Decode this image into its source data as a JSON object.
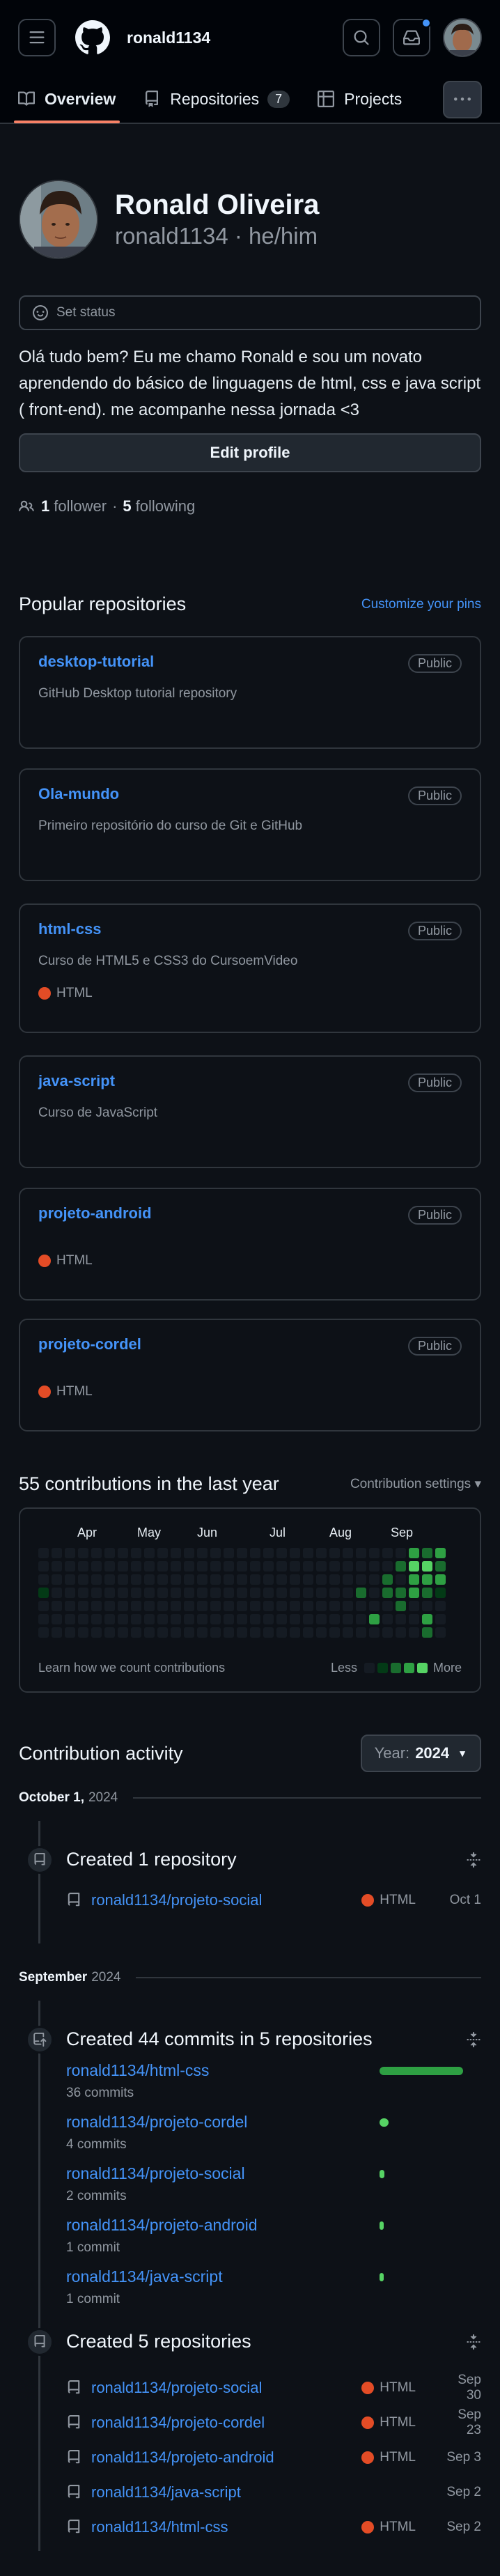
{
  "header": {
    "username": "ronald1134",
    "icons": [
      "menu-icon",
      "github-logo-icon",
      "search-icon",
      "inbox-icon"
    ],
    "has_notification": true
  },
  "tabs": [
    {
      "label": "Overview",
      "active": true
    },
    {
      "label": "Repositories",
      "count": "7"
    },
    {
      "label": "Projects"
    }
  ],
  "profile": {
    "name": "Ronald Oliveira",
    "login_line": "ronald1134 · he/him",
    "set_status": "Set status",
    "bio": "Olá tudo bem? Eu me chamo Ronald e sou um novato aprendendo do básico de linguagens de html, css e java script ( front-end). me acompanhe nessa jornada <3",
    "edit_profile": "Edit profile",
    "followers_count": "1",
    "followers_label": "follower",
    "separator": "·",
    "following_count": "5",
    "following_label": "following"
  },
  "popular": {
    "title": "Popular repositories",
    "customize": "Customize your pins",
    "repos": [
      {
        "name": "desktop-tutorial",
        "visibility": "Public",
        "description": "GitHub Desktop tutorial repository",
        "language": ""
      },
      {
        "name": "Ola-mundo",
        "visibility": "Public",
        "description": "Primeiro repositório do curso de Git e GitHub",
        "language": ""
      },
      {
        "name": "html-css",
        "visibility": "Public",
        "description": "Curso de HTML5 e CSS3 do CursoemVideo",
        "language": "HTML"
      },
      {
        "name": "java-script",
        "visibility": "Public",
        "description": "Curso de JavaScript",
        "language": ""
      },
      {
        "name": "projeto-android",
        "visibility": "Public",
        "description": "",
        "language": "HTML"
      },
      {
        "name": "projeto-cordel",
        "visibility": "Public",
        "description": "",
        "language": "HTML"
      }
    ],
    "language_color": "#e34c26"
  },
  "contributions": {
    "title": "55 contributions in the last year",
    "settings": "Contribution settings",
    "months": [
      "Apr",
      "May",
      "Jun",
      "Jul",
      "Aug",
      "Sep"
    ],
    "learn": "Learn how we count contributions",
    "less": "Less",
    "more": "More",
    "colors": [
      "#151b23",
      "#033a16",
      "#196c2e",
      "#2ea043",
      "#56d364"
    ]
  },
  "activity": {
    "title": "Contribution activity",
    "year_label": "Year:",
    "year": "2024",
    "periods": [
      {
        "month": "October 1,",
        "year": "2024",
        "groups": [
          {
            "title": "Created 1 repository",
            "rows": [
              {
                "name": "ronald1134/projeto-social",
                "language": "HTML",
                "date": "Oct 1"
              }
            ]
          }
        ]
      },
      {
        "month": "September",
        "year": "2024",
        "groups": [
          {
            "title": "Created 44 commits in 5 repositories",
            "commits": [
              {
                "name": "ronald1134/html-css",
                "count": "36 commits",
                "value": 36
              },
              {
                "name": "ronald1134/projeto-cordel",
                "count": "4 commits",
                "value": 4
              },
              {
                "name": "ronald1134/projeto-social",
                "count": "2 commits",
                "value": 2
              },
              {
                "name": "ronald1134/projeto-android",
                "count": "1 commit",
                "value": 1
              },
              {
                "name": "ronald1134/java-script",
                "count": "1 commit",
                "value": 1
              }
            ]
          },
          {
            "title": "Created 5 repositories",
            "rows": [
              {
                "name": "ronald1134/projeto-social",
                "language": "HTML",
                "date": "Sep 30"
              },
              {
                "name": "ronald1134/projeto-cordel",
                "language": "HTML",
                "date": "Sep 23"
              },
              {
                "name": "ronald1134/projeto-android",
                "language": "HTML",
                "date": "Sep 3"
              },
              {
                "name": "ronald1134/java-script",
                "language": "",
                "date": "Sep 2"
              },
              {
                "name": "ronald1134/html-css",
                "language": "HTML",
                "date": "Sep 2"
              }
            ]
          }
        ]
      }
    ]
  }
}
